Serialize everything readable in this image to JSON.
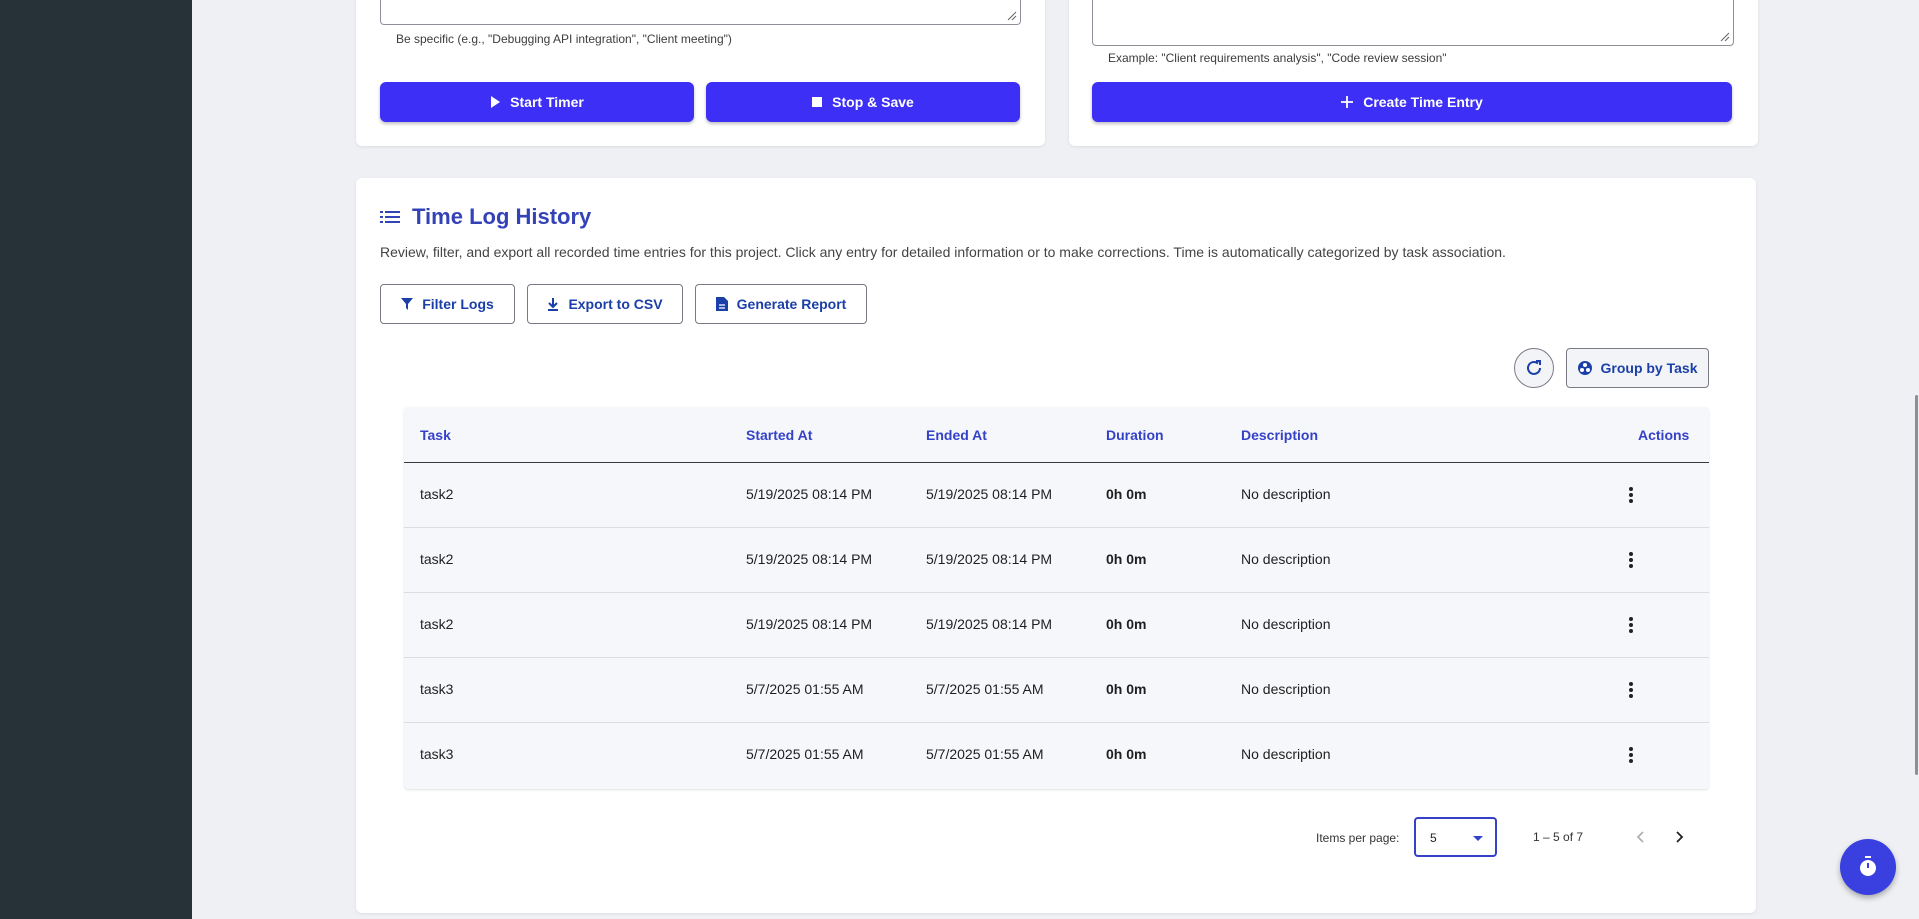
{
  "timer_form": {
    "hint": "Be specific (e.g., \"Debugging API integration\", \"Client meeting\")",
    "start_label": "Start Timer",
    "stop_label": "Stop & Save"
  },
  "manual_form": {
    "hint": "Example: \"Client requirements analysis\", \"Code review session\"",
    "create_label": "Create Time Entry"
  },
  "history": {
    "title": "Time Log History",
    "description": "Review, filter, and export all recorded time entries for this project. Click any entry for detailed information or to make corrections. Time is automatically categorized by task association.",
    "filter_label": "Filter Logs",
    "export_label": "Export to CSV",
    "report_label": "Generate Report",
    "group_label": "Group by Task",
    "columns": {
      "task": "Task",
      "started": "Started At",
      "ended": "Ended At",
      "duration": "Duration",
      "description": "Description",
      "actions": "Actions"
    },
    "rows": [
      {
        "task": "task2",
        "started": "5/19/2025 08:14 PM",
        "ended": "5/19/2025 08:14 PM",
        "duration": "0h 0m",
        "description": "No description"
      },
      {
        "task": "task2",
        "started": "5/19/2025 08:14 PM",
        "ended": "5/19/2025 08:14 PM",
        "duration": "0h 0m",
        "description": "No description"
      },
      {
        "task": "task2",
        "started": "5/19/2025 08:14 PM",
        "ended": "5/19/2025 08:14 PM",
        "duration": "0h 0m",
        "description": "No description"
      },
      {
        "task": "task3",
        "started": "5/7/2025 01:55 AM",
        "ended": "5/7/2025 01:55 AM",
        "duration": "0h 0m",
        "description": "No description"
      },
      {
        "task": "task3",
        "started": "5/7/2025 01:55 AM",
        "ended": "5/7/2025 01:55 AM",
        "duration": "0h 0m",
        "description": "No description"
      }
    ],
    "paginator": {
      "items_per_page_label": "Items per page:",
      "page_size": "5",
      "range": "1 – 5 of 7"
    }
  },
  "icons": {
    "play": "play-icon",
    "stop": "stop-icon",
    "add": "plus-icon",
    "list": "list-icon",
    "filter": "filter-icon",
    "download": "download-icon",
    "report": "document-icon",
    "refresh": "refresh-icon",
    "group": "workspaces-icon",
    "more": "more-vertical-icon",
    "prev": "chevron-left-icon",
    "next": "chevron-right-icon",
    "timer": "timer-icon"
  },
  "colors": {
    "primary": "#3d2ff5",
    "heading": "#3442b8",
    "sidebar": "#263238"
  }
}
